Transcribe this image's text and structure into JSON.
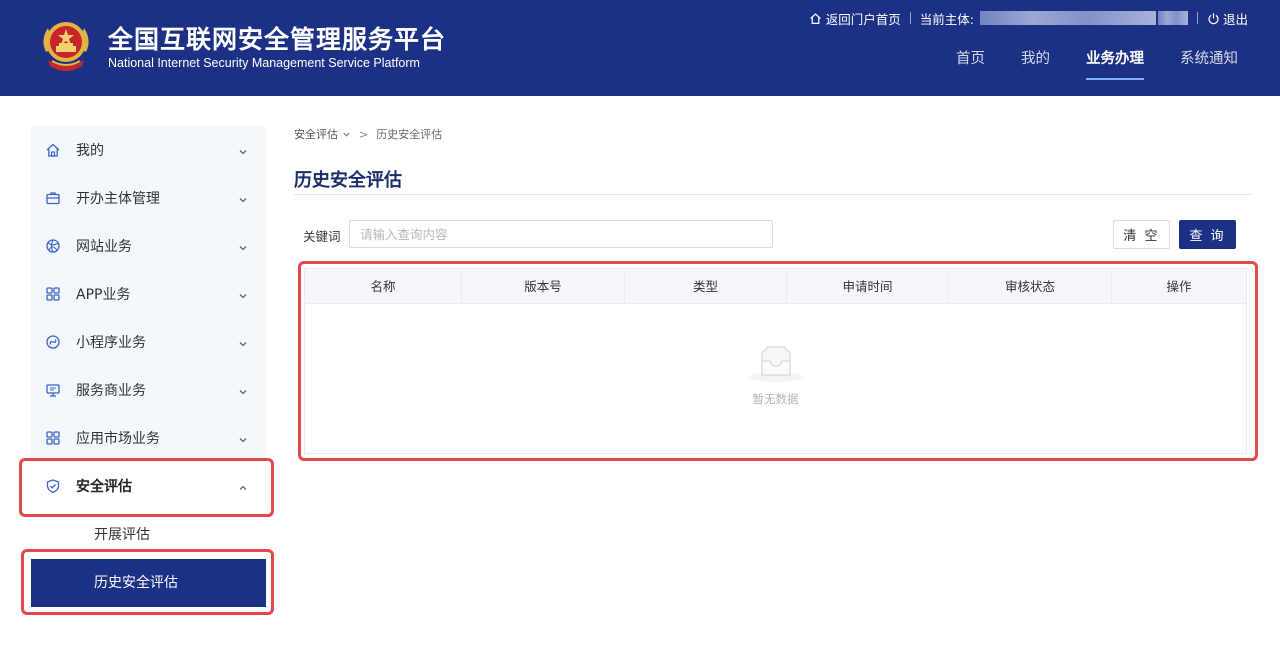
{
  "header": {
    "title": "全国互联网安全管理服务平台",
    "subtitle": "National Internet Security Management Service Platform",
    "portal_link": "返回门户首页",
    "current_entity_label": "当前主体:",
    "logout": "退出",
    "nav": [
      {
        "label": "首页",
        "active": false
      },
      {
        "label": "我的",
        "active": false
      },
      {
        "label": "业务办理",
        "active": true
      },
      {
        "label": "系统通知",
        "active": false
      }
    ]
  },
  "sidebar": {
    "items": [
      {
        "label": "我的",
        "icon": "home-icon"
      },
      {
        "label": "开办主体管理",
        "icon": "briefcase-icon"
      },
      {
        "label": "网站业务",
        "icon": "globe-icon"
      },
      {
        "label": "APP业务",
        "icon": "apps-grid-icon"
      },
      {
        "label": "小程序业务",
        "icon": "mini-program-icon"
      },
      {
        "label": "服务商业务",
        "icon": "monitor-icon"
      },
      {
        "label": "应用市场业务",
        "icon": "grid-icon"
      },
      {
        "label": "安全评估",
        "icon": "shield-icon",
        "expanded": true
      }
    ],
    "sub_items": [
      {
        "label": "开展评估",
        "active": false
      },
      {
        "label": "历史安全评估",
        "active": true
      }
    ]
  },
  "breadcrumb": {
    "first": "安全评估",
    "separator": ">",
    "current": "历史安全评估"
  },
  "page": {
    "title": "历史安全评估"
  },
  "search": {
    "label": "关键词",
    "value": "",
    "placeholder": "请输入查询内容",
    "clear_button": "清 空",
    "query_button": "查 询"
  },
  "table": {
    "columns": [
      "名称",
      "版本号",
      "类型",
      "申请时间",
      "审核状态",
      "操作"
    ],
    "rows": [],
    "empty_text": "暂无数据"
  },
  "colors": {
    "brand": "#1c3185",
    "highlight": "#e2484a",
    "sidebar_bg": "#f4f7fb",
    "icon": "#3b64c8"
  }
}
